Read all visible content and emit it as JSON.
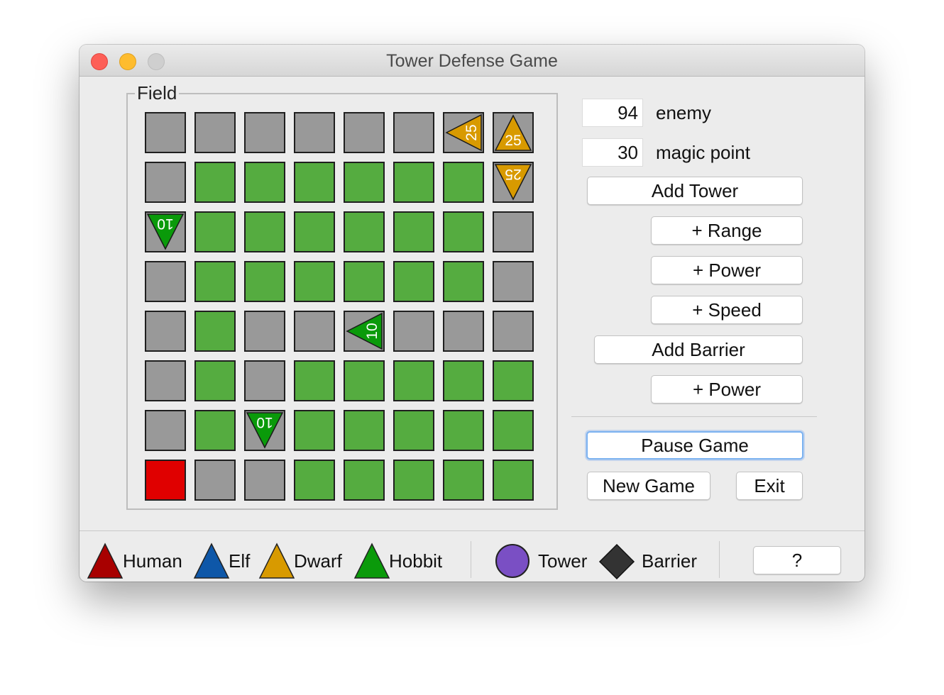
{
  "window": {
    "title": "Tower Defense Game"
  },
  "field": {
    "title": "Field",
    "grid": [
      [
        "road",
        "road",
        "road",
        "road",
        "road",
        "road",
        "road",
        "road"
      ],
      [
        "road",
        "grass",
        "grass",
        "grass",
        "grass",
        "grass",
        "grass",
        "road"
      ],
      [
        "road",
        "grass",
        "grass",
        "grass",
        "grass",
        "grass",
        "grass",
        "road"
      ],
      [
        "road",
        "grass",
        "grass",
        "grass",
        "grass",
        "grass",
        "grass",
        "road"
      ],
      [
        "road",
        "grass",
        "road",
        "road",
        "road",
        "road",
        "road",
        "road"
      ],
      [
        "road",
        "grass",
        "road",
        "grass",
        "grass",
        "grass",
        "grass",
        "grass"
      ],
      [
        "road",
        "grass",
        "road",
        "grass",
        "grass",
        "grass",
        "grass",
        "grass"
      ],
      [
        "base",
        "road",
        "road",
        "grass",
        "grass",
        "grass",
        "grass",
        "grass"
      ]
    ],
    "enemies": [
      {
        "row": 0,
        "col": 6,
        "race": "dwarf",
        "dir": "left",
        "hp": "25"
      },
      {
        "row": 0,
        "col": 7,
        "race": "dwarf",
        "dir": "up",
        "hp": "25"
      },
      {
        "row": 1,
        "col": 7,
        "race": "dwarf",
        "dir": "down",
        "hp": "25"
      },
      {
        "row": 2,
        "col": 0,
        "race": "hobbit",
        "dir": "down",
        "hp": "10"
      },
      {
        "row": 4,
        "col": 4,
        "race": "hobbit",
        "dir": "left",
        "hp": "10"
      },
      {
        "row": 6,
        "col": 2,
        "race": "hobbit",
        "dir": "down",
        "hp": "10"
      }
    ]
  },
  "stats": {
    "enemy_value": "94",
    "enemy_label": "enemy",
    "magic_value": "30",
    "magic_label": "magic point"
  },
  "buttons": {
    "add_tower": "Add Tower",
    "tower_range": "+ Range",
    "tower_power": "+ Power",
    "tower_speed": "+ Speed",
    "add_barrier": "Add Barrier",
    "barrier_power": "+ Power",
    "pause": "Pause Game",
    "new_game": "New Game",
    "exit": "Exit",
    "help": "?"
  },
  "legend": {
    "human": "Human",
    "elf": "Elf",
    "dwarf": "Dwarf",
    "hobbit": "Hobbit",
    "tower": "Tower",
    "barrier": "Barrier"
  },
  "colors": {
    "road": "#999999",
    "grass": "#55ac40",
    "base": "#e00000",
    "human": "#a80000",
    "elf": "#0e57a8",
    "dwarf": "#d89a00",
    "hobbit": "#0a9a0a",
    "tower": "#7a4fc4",
    "barrier": "#333333"
  }
}
